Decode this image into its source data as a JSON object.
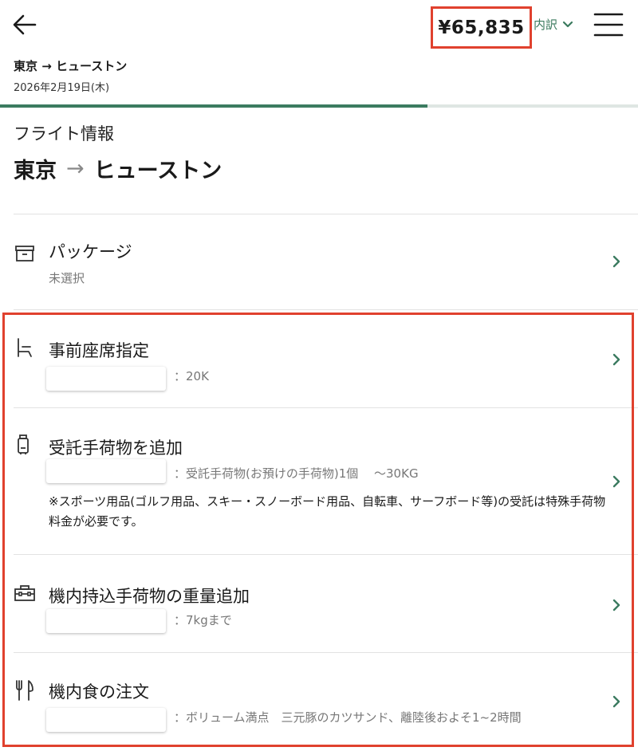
{
  "header": {
    "price": "¥65,835",
    "breakdown_label": "内訳",
    "route": "東京 → ヒューストン",
    "date": "2026年2月19日(木)",
    "progress_percent": 67
  },
  "flight": {
    "section_label": "フライト情報",
    "origin": "東京",
    "arrow": "→",
    "destination": "ヒューストン"
  },
  "package": {
    "title": "パッケージ",
    "status": "未選択"
  },
  "options": [
    {
      "title": "事前座席指定",
      "detail": "：20K"
    },
    {
      "title": "受託手荷物を追加",
      "detail": "：受託手荷物(お預けの手荷物)1個　 ～30KG",
      "note": "※スポーツ用品(ゴルフ用品、スキー・スノーボード用品、自転車、サーフボード等)の受託は特殊手荷物料金が必要です。"
    },
    {
      "title": "機内持込手荷物の重量追加",
      "detail": "：7kgまで"
    },
    {
      "title": "機内食の注文",
      "detail": "：ボリューム満点　三元豚のカツサンド、離陸後およそ1~2時間"
    }
  ],
  "colors": {
    "accent": "#3b7b60",
    "highlight": "#e0412e"
  }
}
